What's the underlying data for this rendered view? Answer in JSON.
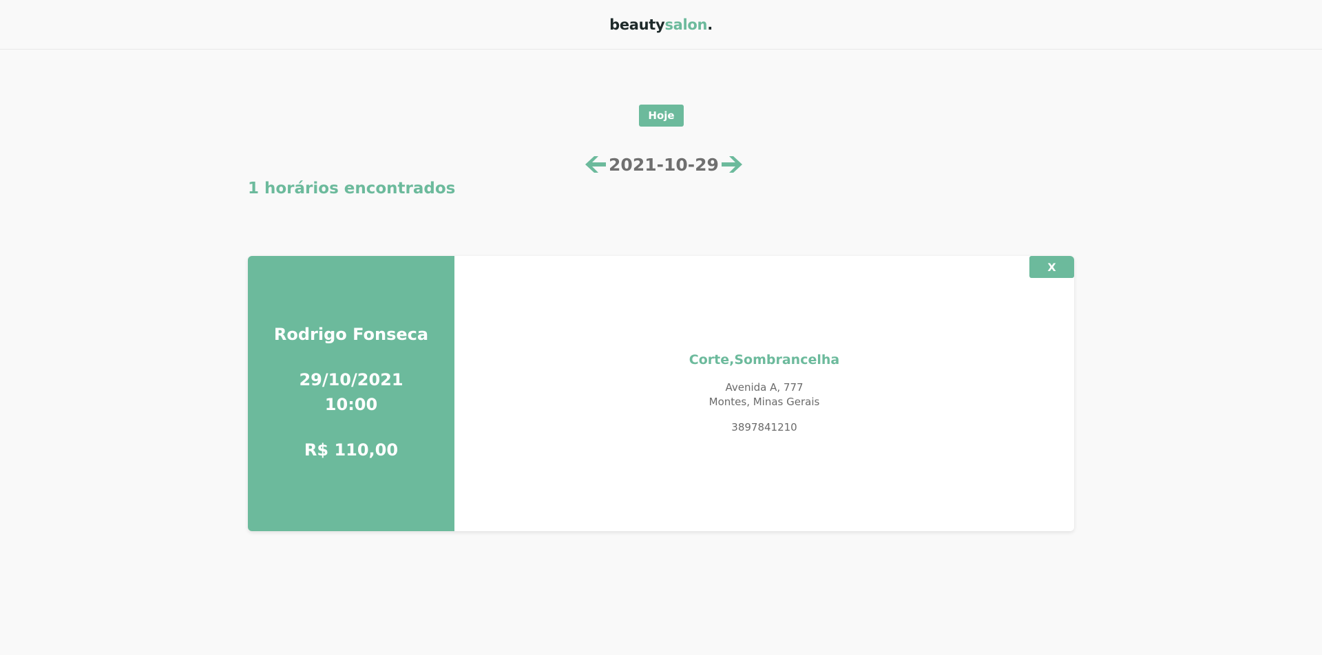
{
  "header": {
    "logo_part1": "beauty",
    "logo_part2": "salon",
    "logo_part3": "."
  },
  "controls": {
    "today_label": "Hoje",
    "prev_icon": "arrow-left-icon",
    "next_icon": "arrow-right-icon",
    "current_date": "2021-10-29"
  },
  "results": {
    "count_text": "1 horários encontrados"
  },
  "appointments": [
    {
      "client_name": "Rodrigo Fonseca",
      "date": "29/10/2021",
      "time": "10:00",
      "price": "R$ 110,00",
      "services": "Corte,Sombrancelha",
      "address_line1": "Avenida A, 777",
      "address_line2": "Montes, Minas Gerais",
      "phone": "3897841210",
      "close_label": "X"
    }
  ],
  "colors": {
    "accent": "#6cba9c",
    "background": "#f9f9f9",
    "logo_dark": "#1e2a2a",
    "text_gray": "#6f6f6f"
  }
}
